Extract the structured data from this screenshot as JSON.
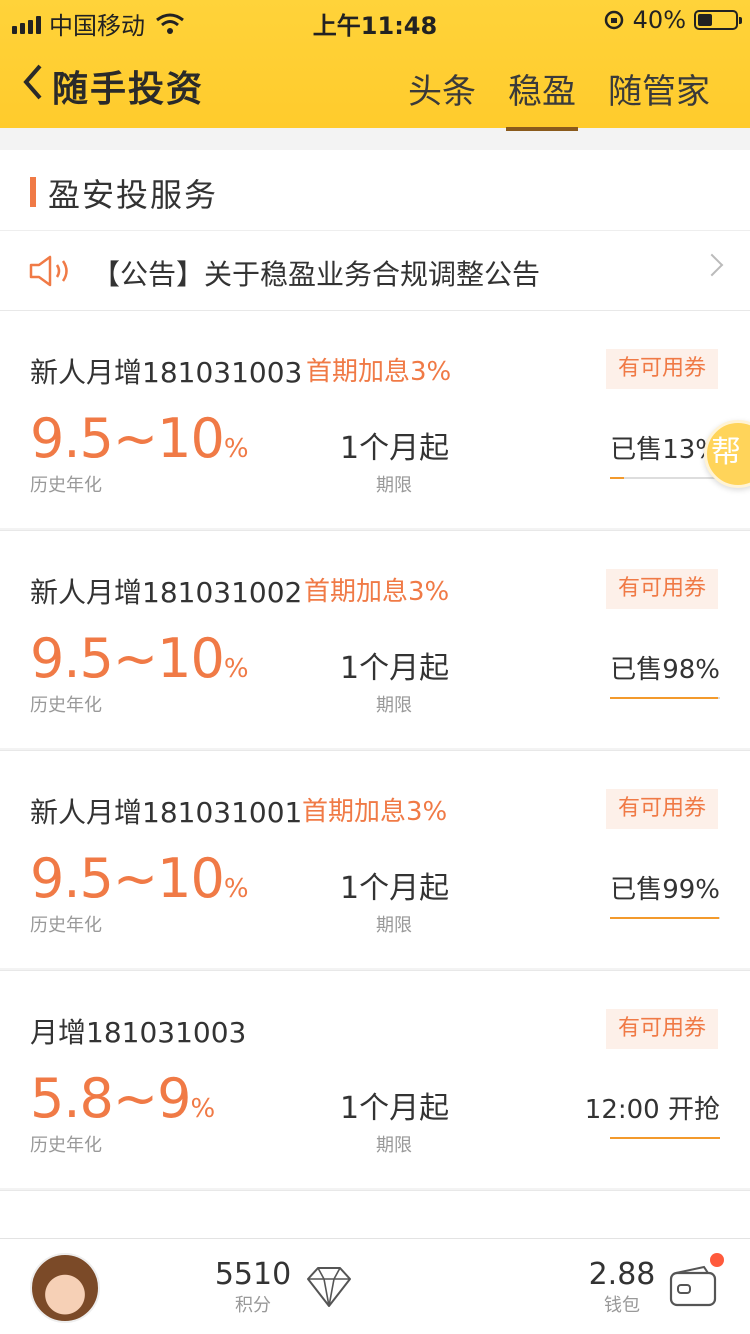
{
  "status": {
    "carrier": "中国移动",
    "time": "上午11:48",
    "battery": "40%",
    "battery_level": 0.4
  },
  "nav": {
    "title": "随手投资",
    "tabs": [
      "头条",
      "稳盈",
      "随管家"
    ],
    "active_tab": 1
  },
  "section": {
    "title": "盈安投服务"
  },
  "notice": {
    "text": "【公告】关于稳盈业务合规调整公告"
  },
  "products": [
    {
      "name": "新人月增181031003",
      "bonus": "首期加息3%",
      "coupon": "有可用券",
      "rate": "9.5~10",
      "rate_unit": "%",
      "rate_label": "历史年化",
      "term": "1个月起",
      "term_label": "期限",
      "status": "已售13%",
      "progress": 0.13
    },
    {
      "name": "新人月增181031002",
      "bonus": "首期加息3%",
      "coupon": "有可用券",
      "rate": "9.5~10",
      "rate_unit": "%",
      "rate_label": "历史年化",
      "term": "1个月起",
      "term_label": "期限",
      "status": "已售98%",
      "progress": 0.98
    },
    {
      "name": "新人月增181031001",
      "bonus": "首期加息3%",
      "coupon": "有可用券",
      "rate": "9.5~10",
      "rate_unit": "%",
      "rate_label": "历史年化",
      "term": "1个月起",
      "term_label": "期限",
      "status": "已售99%",
      "progress": 0.99
    },
    {
      "name": "月增181031003",
      "bonus": "",
      "coupon": "有可用券",
      "rate": "5.8~9",
      "rate_unit": "%",
      "rate_label": "历史年化",
      "term": "1个月起",
      "term_label": "期限",
      "status": "12:00 开抢",
      "progress": 1.0
    }
  ],
  "floating": {
    "label": "帮"
  },
  "bottom": {
    "points": "5510",
    "points_label": "积分",
    "wallet": "2.88",
    "wallet_label": "钱包"
  },
  "colors": {
    "brand": "#ffd33a",
    "accent": "#f07a46",
    "progress": "#f39a2c"
  },
  "icons": [
    "back-arrow-icon",
    "wifi-icon",
    "speaker-icon",
    "chevron-right-icon",
    "diamond-icon",
    "wallet-icon"
  ]
}
